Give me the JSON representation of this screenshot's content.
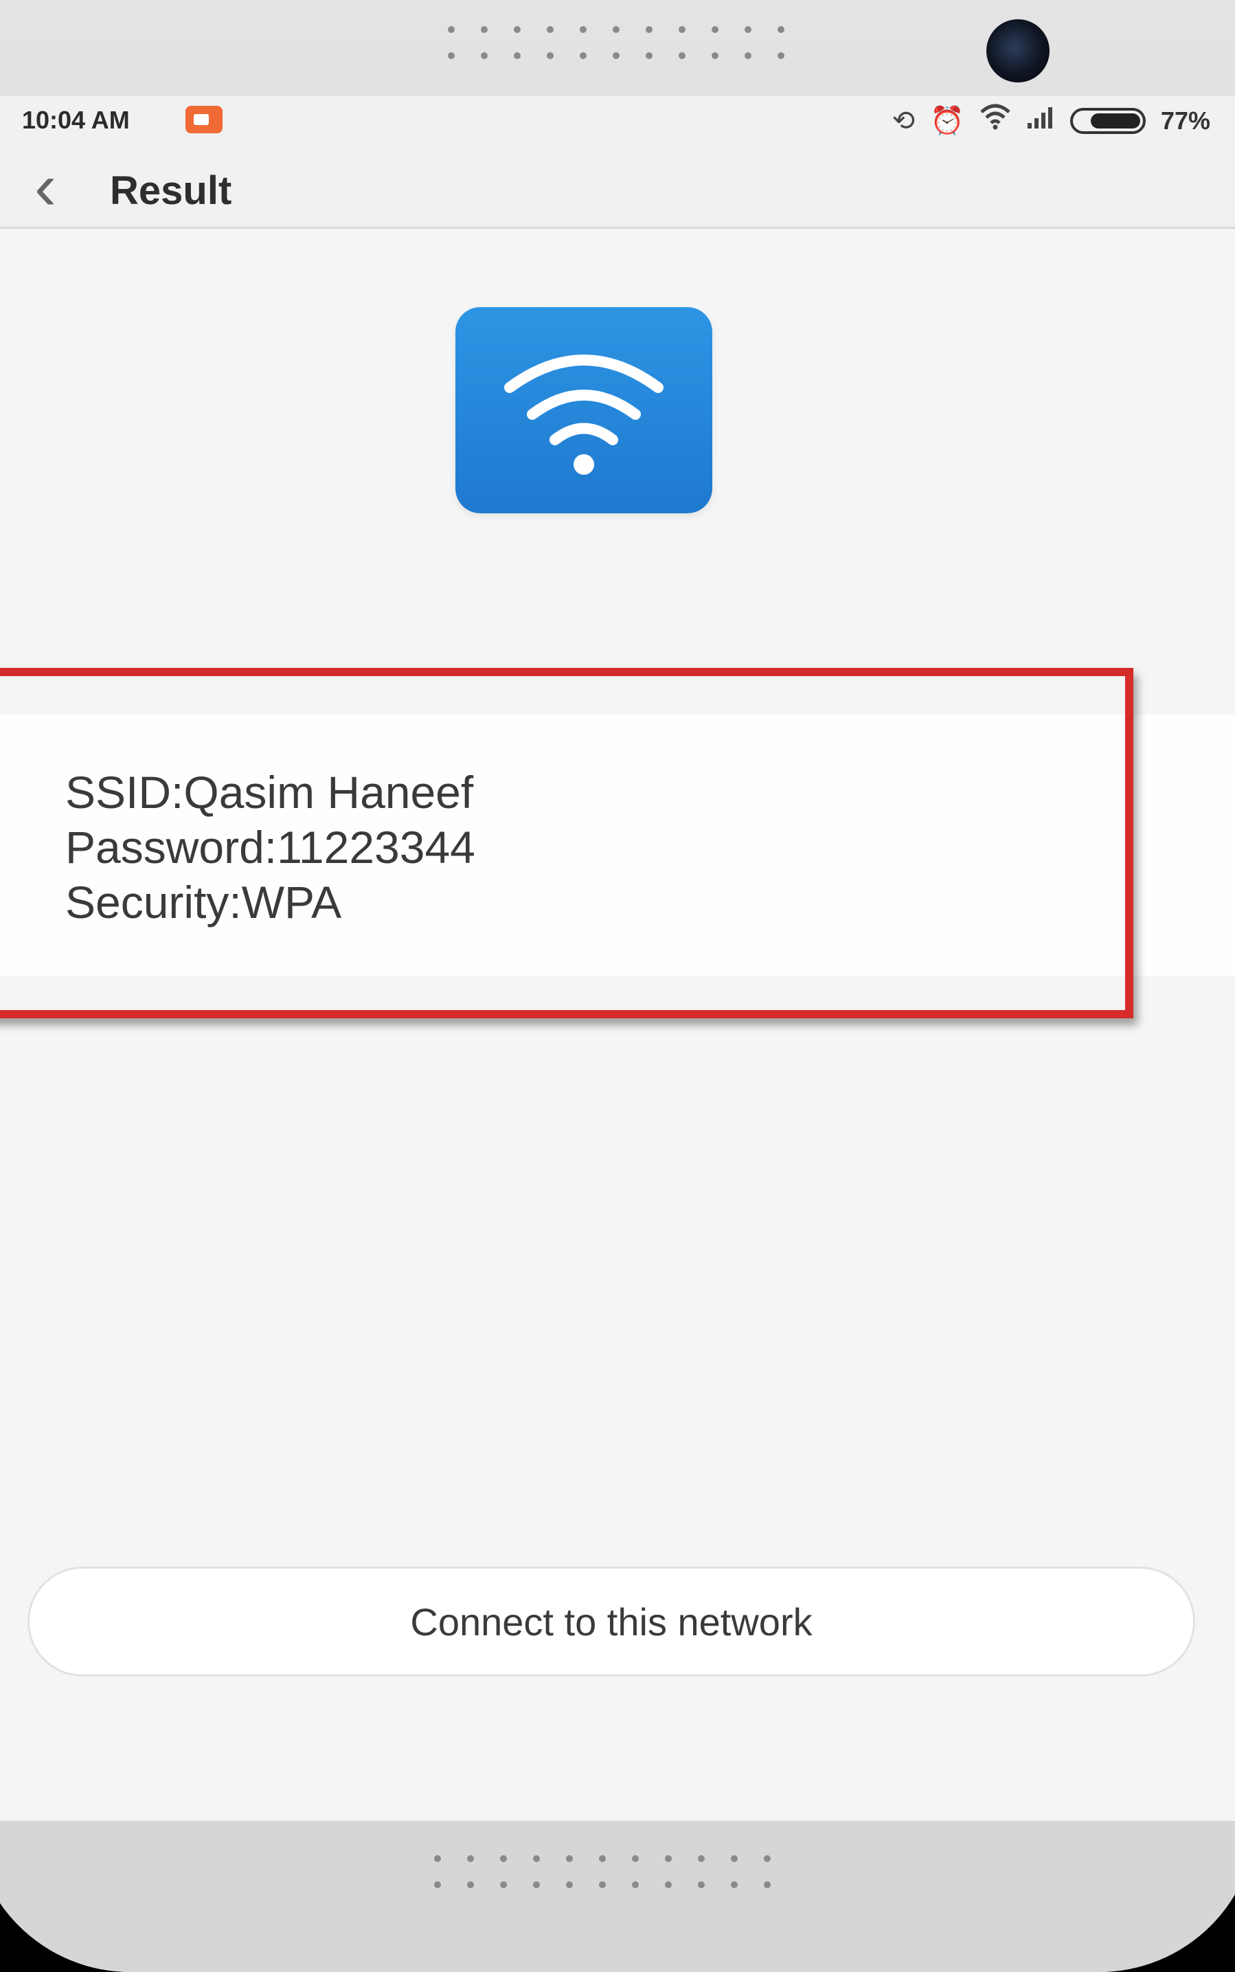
{
  "status_bar": {
    "time": "10:04 AM",
    "battery_percent": "77%",
    "battery_level": 0.77,
    "icons": [
      "screen-recorder-icon",
      "rotate-lock-icon",
      "alarm-icon",
      "wifi-signal-icon",
      "cellular-signal-icon",
      "battery-icon"
    ]
  },
  "header": {
    "back_icon": "chevron-left-icon",
    "title": "Result"
  },
  "wifi_tile": {
    "icon": "wifi-icon",
    "color": "#1f79cf"
  },
  "result": {
    "ssid": "SSID:Qasim Haneef",
    "password": "Password:11223344",
    "security": "Security:WPA",
    "highlight_color": "#d52b2b"
  },
  "actions": {
    "connect_label": "Connect to this network"
  }
}
